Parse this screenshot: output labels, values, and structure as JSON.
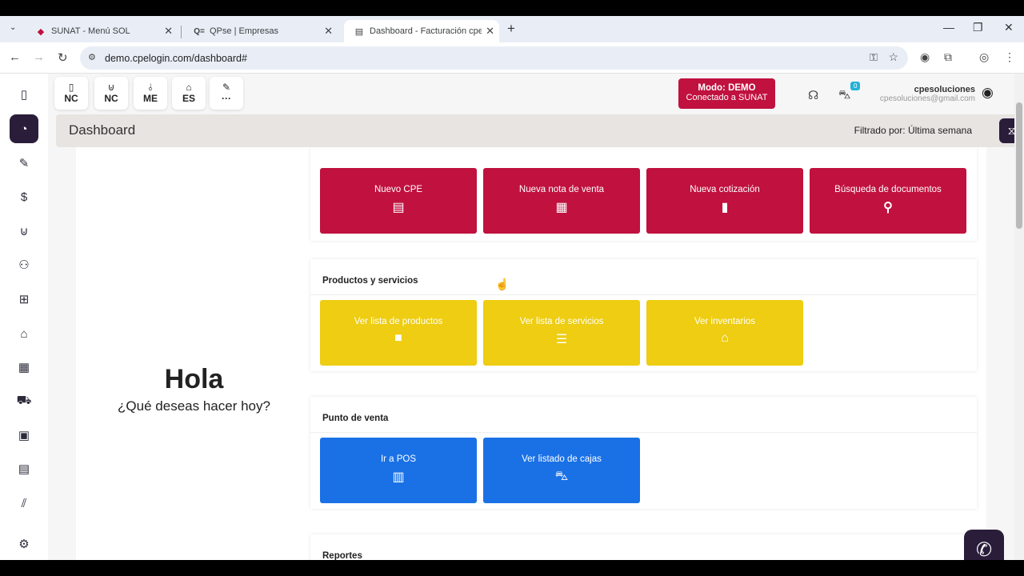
{
  "browser": {
    "tabs": [
      {
        "title": "SUNAT - Menú SOL",
        "favicon": "sunat-logo"
      },
      {
        "title": "QPse | Empresas",
        "favicon": "qpse-logo"
      },
      {
        "title": "Dashboard - Facturación cpe so",
        "favicon": "document-icon"
      }
    ],
    "new_tab": "+",
    "url": "demo.cpelogin.com/dashboard#"
  },
  "toolbar": {
    "quick_buttons": [
      {
        "label": "NC",
        "icon": "document-icon"
      },
      {
        "label": "NC",
        "icon": "bag-icon"
      },
      {
        "label": "ME",
        "icon": "chart-icon"
      },
      {
        "label": "ES",
        "icon": "store-icon"
      },
      {
        "label": "···",
        "icon": "edit-icon"
      }
    ],
    "mode_title": "Modo: DEMO",
    "mode_subtitle": "Conectado a SUNAT",
    "cart_count": "0",
    "user_name": "cpesoluciones",
    "user_email": "cpesoluciones@gmail.com"
  },
  "dashboard": {
    "title": "Dashboard",
    "filter_label": "Filtrado por: Última semana"
  },
  "greeting": {
    "title": "Hola",
    "subtitle": "¿Qué deseas hacer hoy?"
  },
  "sections": {
    "top_cards": [
      {
        "label": "Nuevo CPE",
        "icon": "file-text-icon"
      },
      {
        "label": "Nueva nota de venta",
        "icon": "receipt-icon"
      },
      {
        "label": "Nueva cotización",
        "icon": "file-icon"
      },
      {
        "label": "Búsqueda de documentos",
        "icon": "search-icon"
      }
    ],
    "productos": {
      "title": "Productos y servicios",
      "cards": [
        {
          "label": "Ver lista de productos",
          "icon": "box-icon"
        },
        {
          "label": "Ver lista de servicios",
          "icon": "list-icon"
        },
        {
          "label": "Ver inventarios",
          "icon": "warehouse-icon"
        }
      ]
    },
    "pos": {
      "title": "Punto de venta",
      "cards": [
        {
          "label": "Ir a POS",
          "icon": "cash-register-icon"
        },
        {
          "label": "Ver listado de cajas",
          "icon": "cart-plus-icon"
        }
      ]
    },
    "reportes": {
      "title": "Reportes"
    }
  },
  "colors": {
    "brand_red": "#c0113f",
    "yellow": "#eecd12",
    "blue": "#1a71e6",
    "dark": "#2a1d3a"
  }
}
